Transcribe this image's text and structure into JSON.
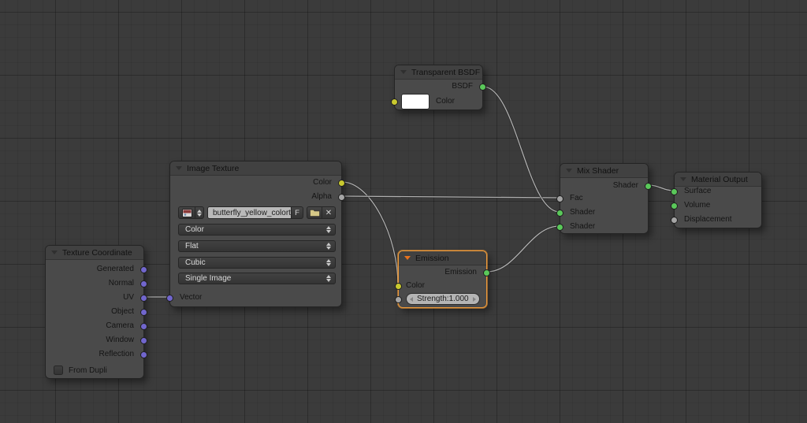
{
  "editor": {
    "type_label": "Node Editor"
  },
  "colors": {
    "socket_shader": "#5ac85a",
    "socket_color": "#c9c92f",
    "socket_value": "#a5a5a5",
    "socket_vector": "#7166cd",
    "selection_outline": "#ee9a3a",
    "node_body": "#4a4a4a",
    "node_header": "#414141",
    "background": "#3b3b3b",
    "wire": "#b0b0b0"
  },
  "nodes": {
    "texture_coordinate": {
      "title": "Texture Coordinate",
      "outputs": [
        "Generated",
        "Normal",
        "UV",
        "Object",
        "Camera",
        "Window",
        "Reflection"
      ],
      "checkbox_label": "From Dupli",
      "checkbox_checked": false
    },
    "image_texture": {
      "title": "Image Texture",
      "outputs": [
        "Color",
        "Alpha"
      ],
      "filename": "butterfly_yellow_colortex.p...",
      "fake_user_label": "F",
      "dropdowns": [
        "Color",
        "Flat",
        "Cubic",
        "Single Image"
      ],
      "inputs": [
        "Vector"
      ]
    },
    "transparent_bsdf": {
      "title": "Transparent BSDF",
      "outputs": [
        "BSDF"
      ],
      "inputs": [
        "Color"
      ],
      "color_value": "#ffffff"
    },
    "emission": {
      "title": "Emission",
      "selected": true,
      "outputs": [
        "Emission"
      ],
      "inputs": [
        "Color"
      ],
      "strength_label": "Strength:",
      "strength_value": "1.000"
    },
    "mix_shader": {
      "title": "Mix Shader",
      "outputs": [
        "Shader"
      ],
      "inputs": [
        "Fac",
        "Shader",
        "Shader"
      ]
    },
    "material_output": {
      "title": "Material Output",
      "inputs": [
        "Surface",
        "Volume",
        "Displacement"
      ]
    }
  },
  "connections": [
    "Texture Coordinate.UV -> Image Texture.Vector",
    "Image Texture.Color -> Emission.Color",
    "Image Texture.Alpha -> Mix Shader.Fac",
    "Transparent BSDF.BSDF -> Mix Shader.Shader1",
    "Emission.Emission -> Mix Shader.Shader2",
    "Mix Shader.Shader -> Material Output.Surface"
  ]
}
